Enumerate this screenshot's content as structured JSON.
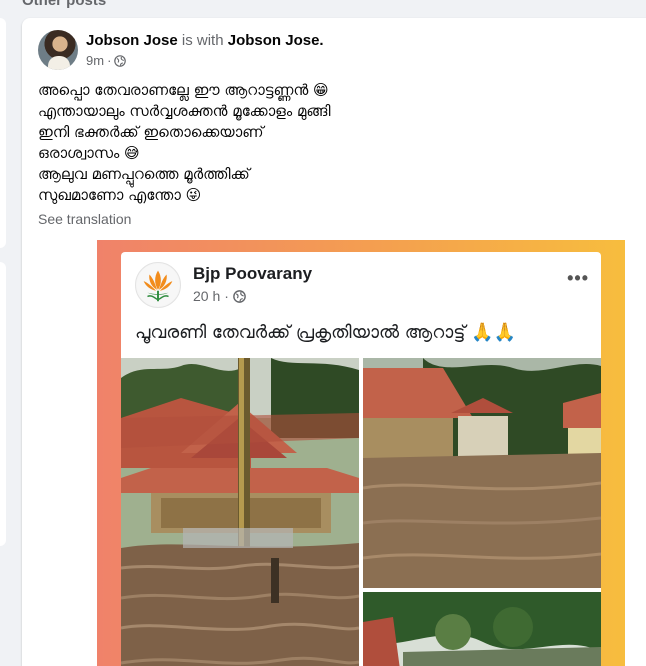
{
  "section": {
    "title": "Other posts"
  },
  "post": {
    "author": "Jobson Jose",
    "with_text": "is with",
    "tagged": "Jobson Jose.",
    "time": "9m",
    "separator": "·",
    "privacy_icon": "globe-icon",
    "lines": [
      "അപ്പൊ തേവരാണല്ലേ ഈ ആറാട്ടണ്ണൻ 😁",
      "എന്തായാലും സർവ്വശക്തൻ മൂക്കോളം മുങ്ങി",
      "ഇനി ഭക്തർക്ക് ഇതൊക്കെയാണ്",
      "ഒരാശ്വാസം 😅",
      "ആലുവ മണപ്പുറത്തെ മൂർത്തിക്ക്",
      "സുഖമാണോ എന്തോ 😜"
    ],
    "see_translation": "See translation"
  },
  "shared": {
    "page_name": "Bjp Poovarany",
    "time": "20 h",
    "separator": "·",
    "more_icon": "more-options-icon",
    "text": "പൂവരണി തേവർക്ക് പ്രകൃതിയാൽ ആറാട്ട് 🙏🙏"
  },
  "colors": {
    "frame_left": "#f0826a",
    "frame_right": "#f7bd3e",
    "flood_water": "#8b6f52",
    "roof_tile": "#c2624a"
  }
}
